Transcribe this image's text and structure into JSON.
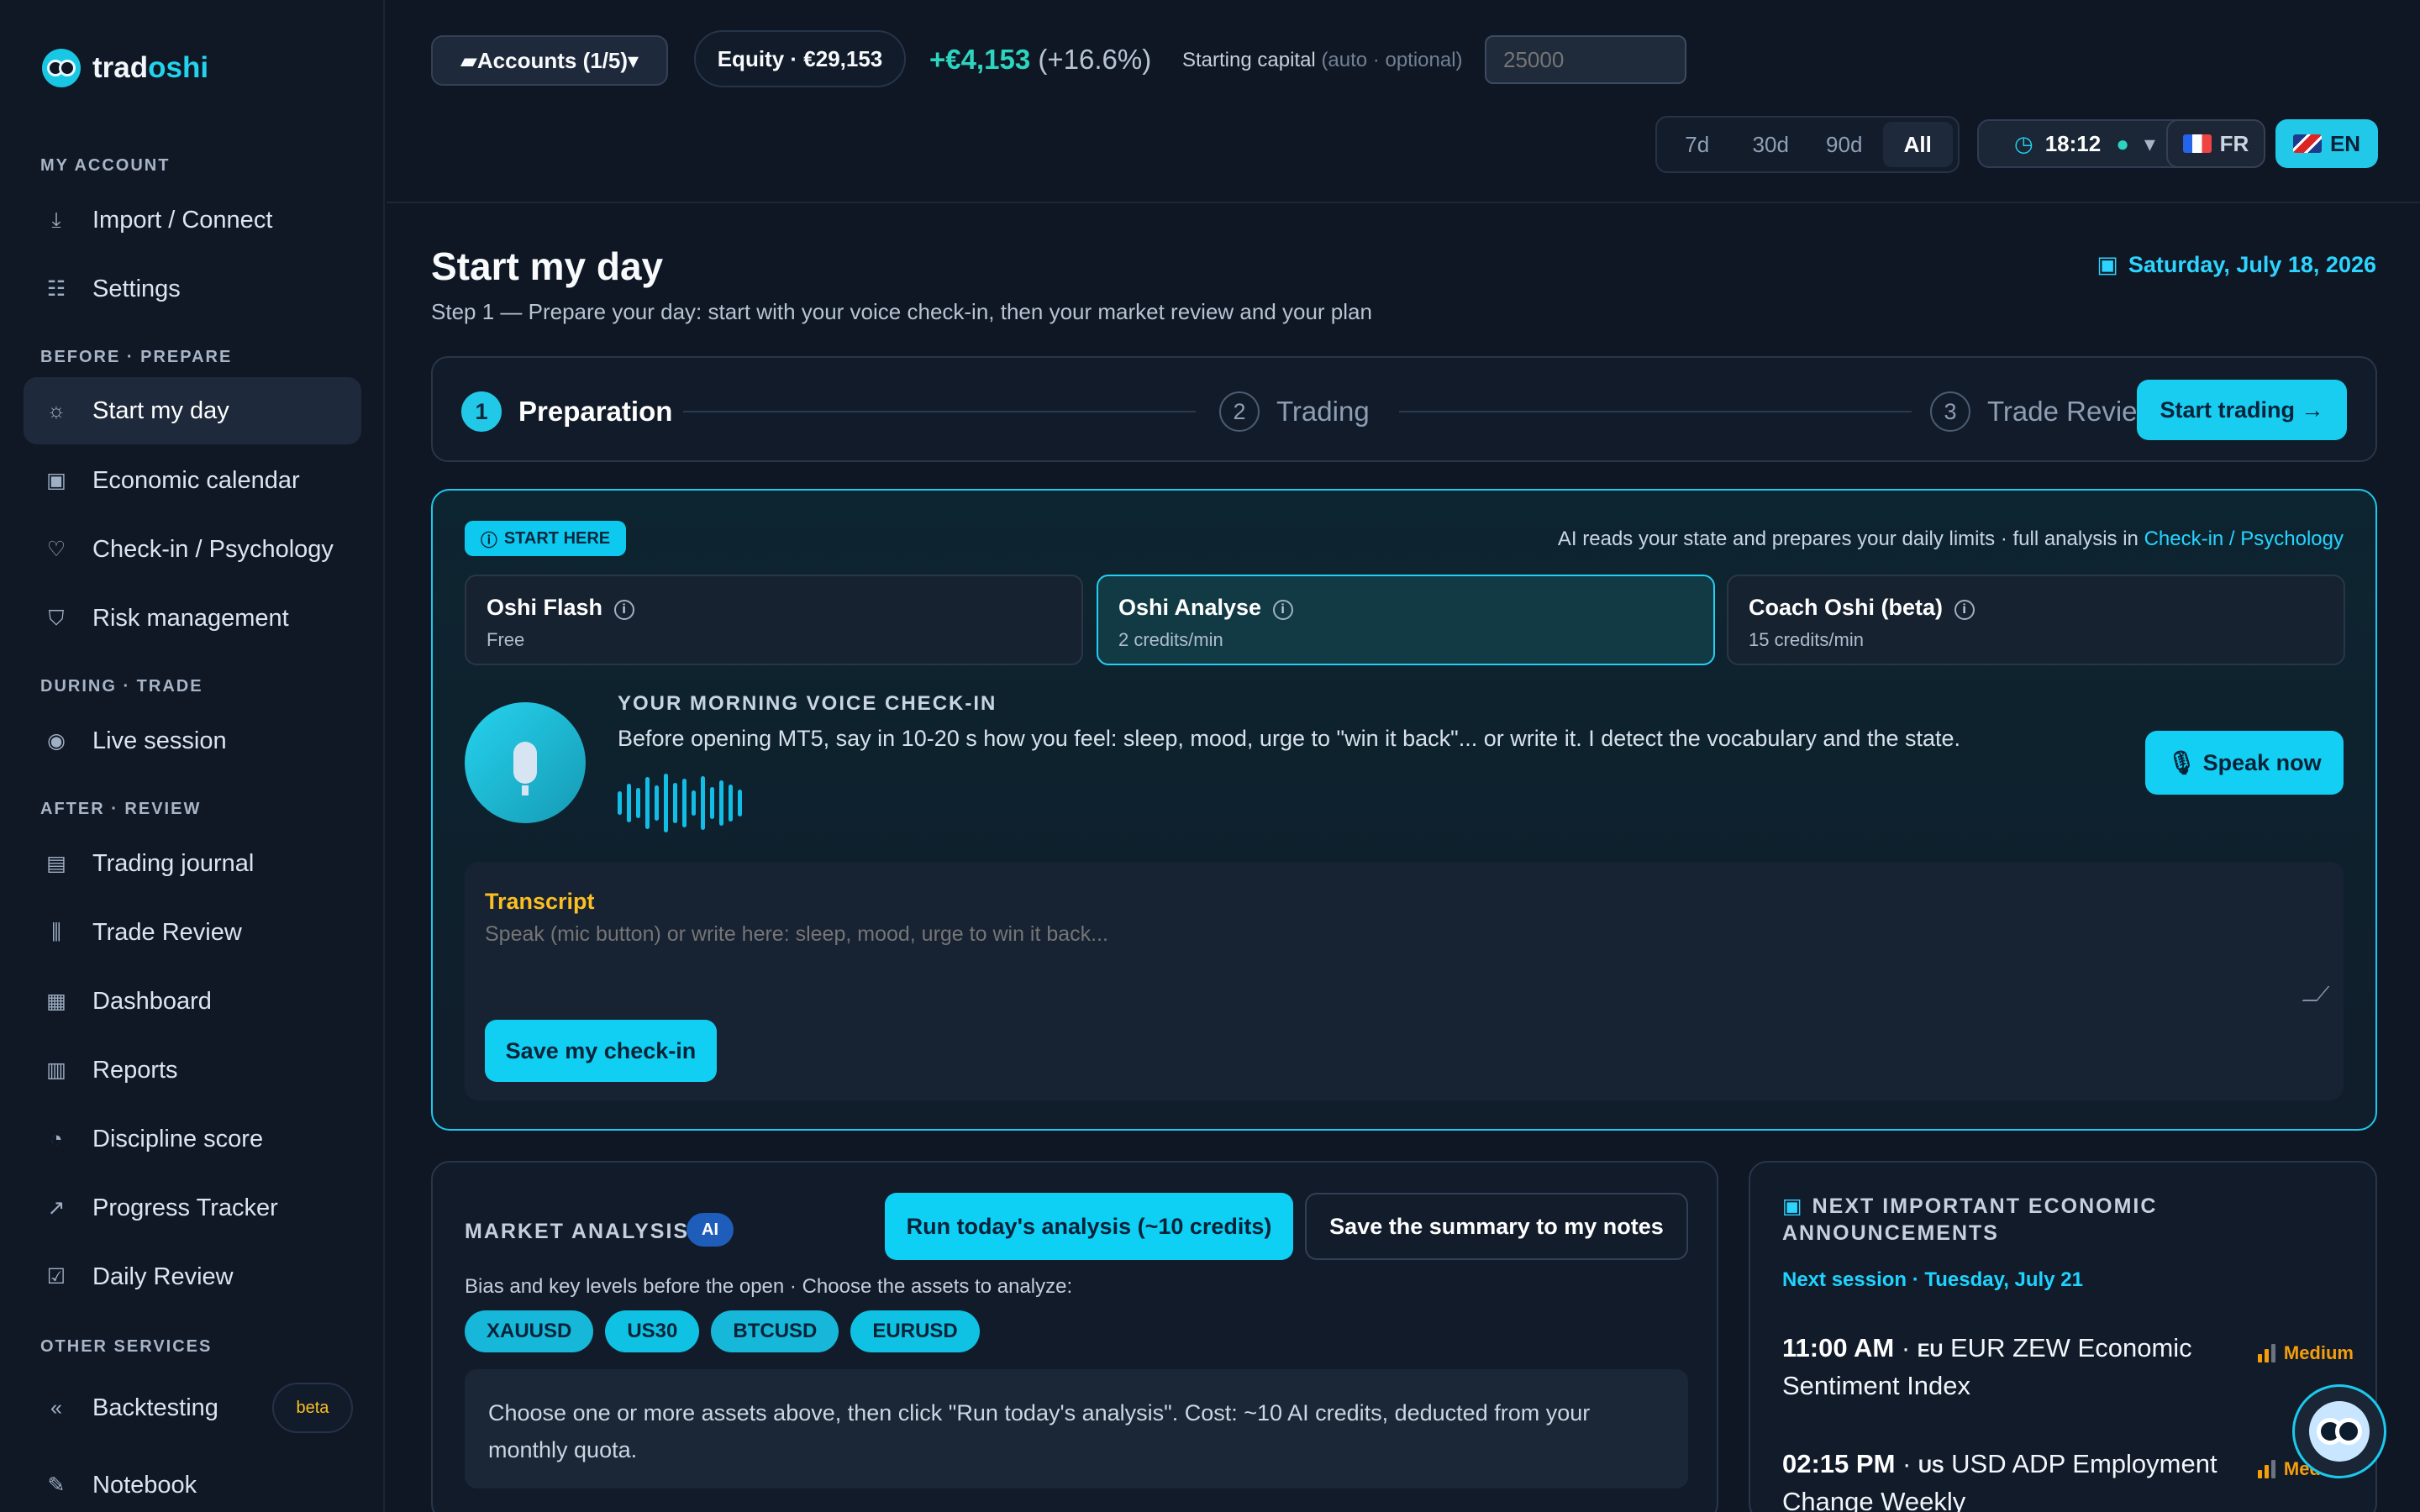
{
  "brand": {
    "part1": "trad",
    "part2": "oshi"
  },
  "sidebar": {
    "sections": [
      "MY ACCOUNT",
      "BEFORE · PREPARE",
      "DURING · TRADE",
      "AFTER · REVIEW",
      "OTHER SERVICES"
    ],
    "items": [
      {
        "label": "Import / Connect",
        "icon": "download-icon"
      },
      {
        "label": "Settings",
        "icon": "sliders-icon"
      },
      {
        "label": "Start my day",
        "icon": "sunrise-icon",
        "active": true
      },
      {
        "label": "Economic calendar",
        "icon": "calendar-icon"
      },
      {
        "label": "Check-in / Psychology",
        "icon": "heart-icon"
      },
      {
        "label": "Risk management",
        "icon": "shield-icon"
      },
      {
        "label": "Live session",
        "icon": "broadcast-icon"
      },
      {
        "label": "Trading journal",
        "icon": "book-icon"
      },
      {
        "label": "Trade Review",
        "icon": "candles-icon"
      },
      {
        "label": "Dashboard",
        "icon": "dashboard-icon"
      },
      {
        "label": "Reports",
        "icon": "report-icon"
      },
      {
        "label": "Discipline score",
        "icon": "gauge-icon"
      },
      {
        "label": "Progress Tracker",
        "icon": "trend-icon"
      },
      {
        "label": "Daily Review",
        "icon": "clipboard-icon"
      },
      {
        "label": "Backtesting",
        "icon": "rewind-icon",
        "badge": "beta"
      },
      {
        "label": "Notebook",
        "icon": "edit-icon"
      }
    ]
  },
  "topbar": {
    "accounts": "Accounts (1/5)",
    "equity": "Equity · €29,153",
    "gain": "+€4,153",
    "gain_pct": "(+16.6%)",
    "capital_label": "Starting capital",
    "capital_hint": "(auto · optional)",
    "capital_placeholder": "25000",
    "periods": [
      "7d",
      "30d",
      "90d",
      "All"
    ],
    "time": "18:12",
    "lang_fr": "FR",
    "lang_en": "EN"
  },
  "page": {
    "title": "Start my day",
    "subtitle": "Step 1 — Prepare your day: start with your voice check-in, then your market review and your plan",
    "date": "Saturday, July 18, 2026"
  },
  "stepper": {
    "steps": [
      {
        "num": "1",
        "label": "Preparation"
      },
      {
        "num": "2",
        "label": "Trading"
      },
      {
        "num": "3",
        "label": "Trade Review"
      }
    ],
    "action": "Start trading →"
  },
  "checkin": {
    "badge": "START HERE",
    "note": "AI reads your state and prepares your daily limits · full analysis in",
    "note_link": "Check-in / Psychology",
    "plans": [
      {
        "name": "Oshi Flash",
        "price": "Free"
      },
      {
        "name": "Oshi Analyse",
        "price": "2 credits/min"
      },
      {
        "name": "Coach Oshi (beta)",
        "price": "15 credits/min"
      }
    ],
    "voice_title": "YOUR MORNING VOICE CHECK-IN",
    "voice_text": "Before opening MT5, say in 10-20 s how you feel: sleep, mood, urge to \"win it back\"... or write it. I detect the vocabulary and the state.",
    "speak": "Speak now",
    "transcript_label": "Transcript",
    "transcript_placeholder": "Speak (mic button) or write here: sleep, mood, urge to win it back...",
    "save": "Save my check-in"
  },
  "market": {
    "title": "MARKET ANALYSIS",
    "ai": "AI",
    "run": "Run today's analysis (~10 credits)",
    "save": "Save the summary to my notes",
    "subtitle": "Bias and key levels before the open · Choose the assets to analyze:",
    "assets": [
      "XAUUSD",
      "US30",
      "BTCUSD",
      "EURUSD"
    ],
    "help": "Choose one or more assets above, then click \"Run today's analysis\". Cost: ~10 AI credits, deducted from your monthly quota."
  },
  "economic": {
    "title": "NEXT IMPORTANT ECONOMIC ANNOUNCEMENTS",
    "session": "Next session · Tuesday, July 21",
    "events": [
      {
        "time": "11:00 AM",
        "code": "EU",
        "text": "EUR ZEW Economic Sentiment Index",
        "impact": "Medium"
      },
      {
        "time": "02:15 PM",
        "code": "US",
        "text": "USD ADP Employment Change Weekly",
        "impact": "Medium"
      }
    ]
  },
  "colors": {
    "accent": "#22d3ee",
    "gain": "#2dd4bf",
    "warning": "#f59e0b",
    "bg": "#0f1724"
  }
}
